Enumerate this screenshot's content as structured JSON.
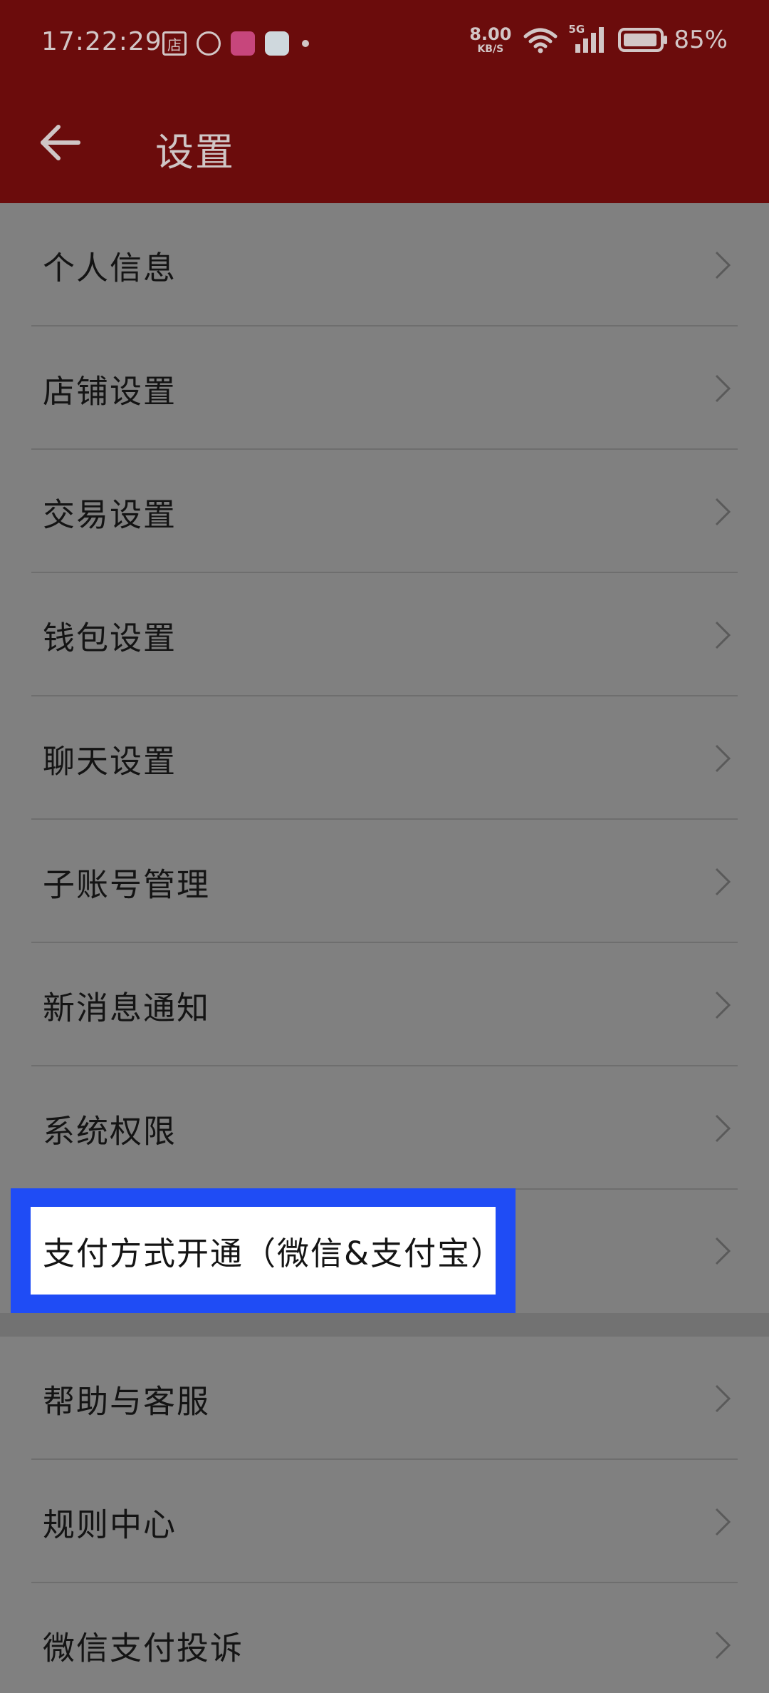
{
  "status_bar": {
    "time": "17:22:29",
    "app_icon_shop_label": "店",
    "net_speed_value": "8.00",
    "net_speed_unit": "KB/S",
    "network_type": "5G",
    "battery_percent": "85%"
  },
  "header": {
    "title": "设置"
  },
  "settings": {
    "group1": [
      {
        "label": "个人信息"
      },
      {
        "label": "店铺设置"
      },
      {
        "label": "交易设置"
      },
      {
        "label": "钱包设置"
      },
      {
        "label": "聊天设置"
      },
      {
        "label": "子账号管理"
      },
      {
        "label": "新消息通知"
      },
      {
        "label": "系统权限"
      },
      {
        "label": "支付方式开通（微信&支付宝）"
      }
    ],
    "group2": [
      {
        "label": "帮助与客服"
      },
      {
        "label": "规则中心"
      },
      {
        "label": "微信支付投诉"
      }
    ]
  },
  "colors": {
    "header_bg": "#6b0c0c",
    "overlay_bg": "#808080",
    "highlight_border": "#1f4cf5"
  },
  "icons": {
    "back": "arrow-left-icon",
    "chevron": "chevron-right-icon",
    "wifi": "wifi-icon",
    "signal": "signal-icon",
    "battery": "battery-icon"
  }
}
